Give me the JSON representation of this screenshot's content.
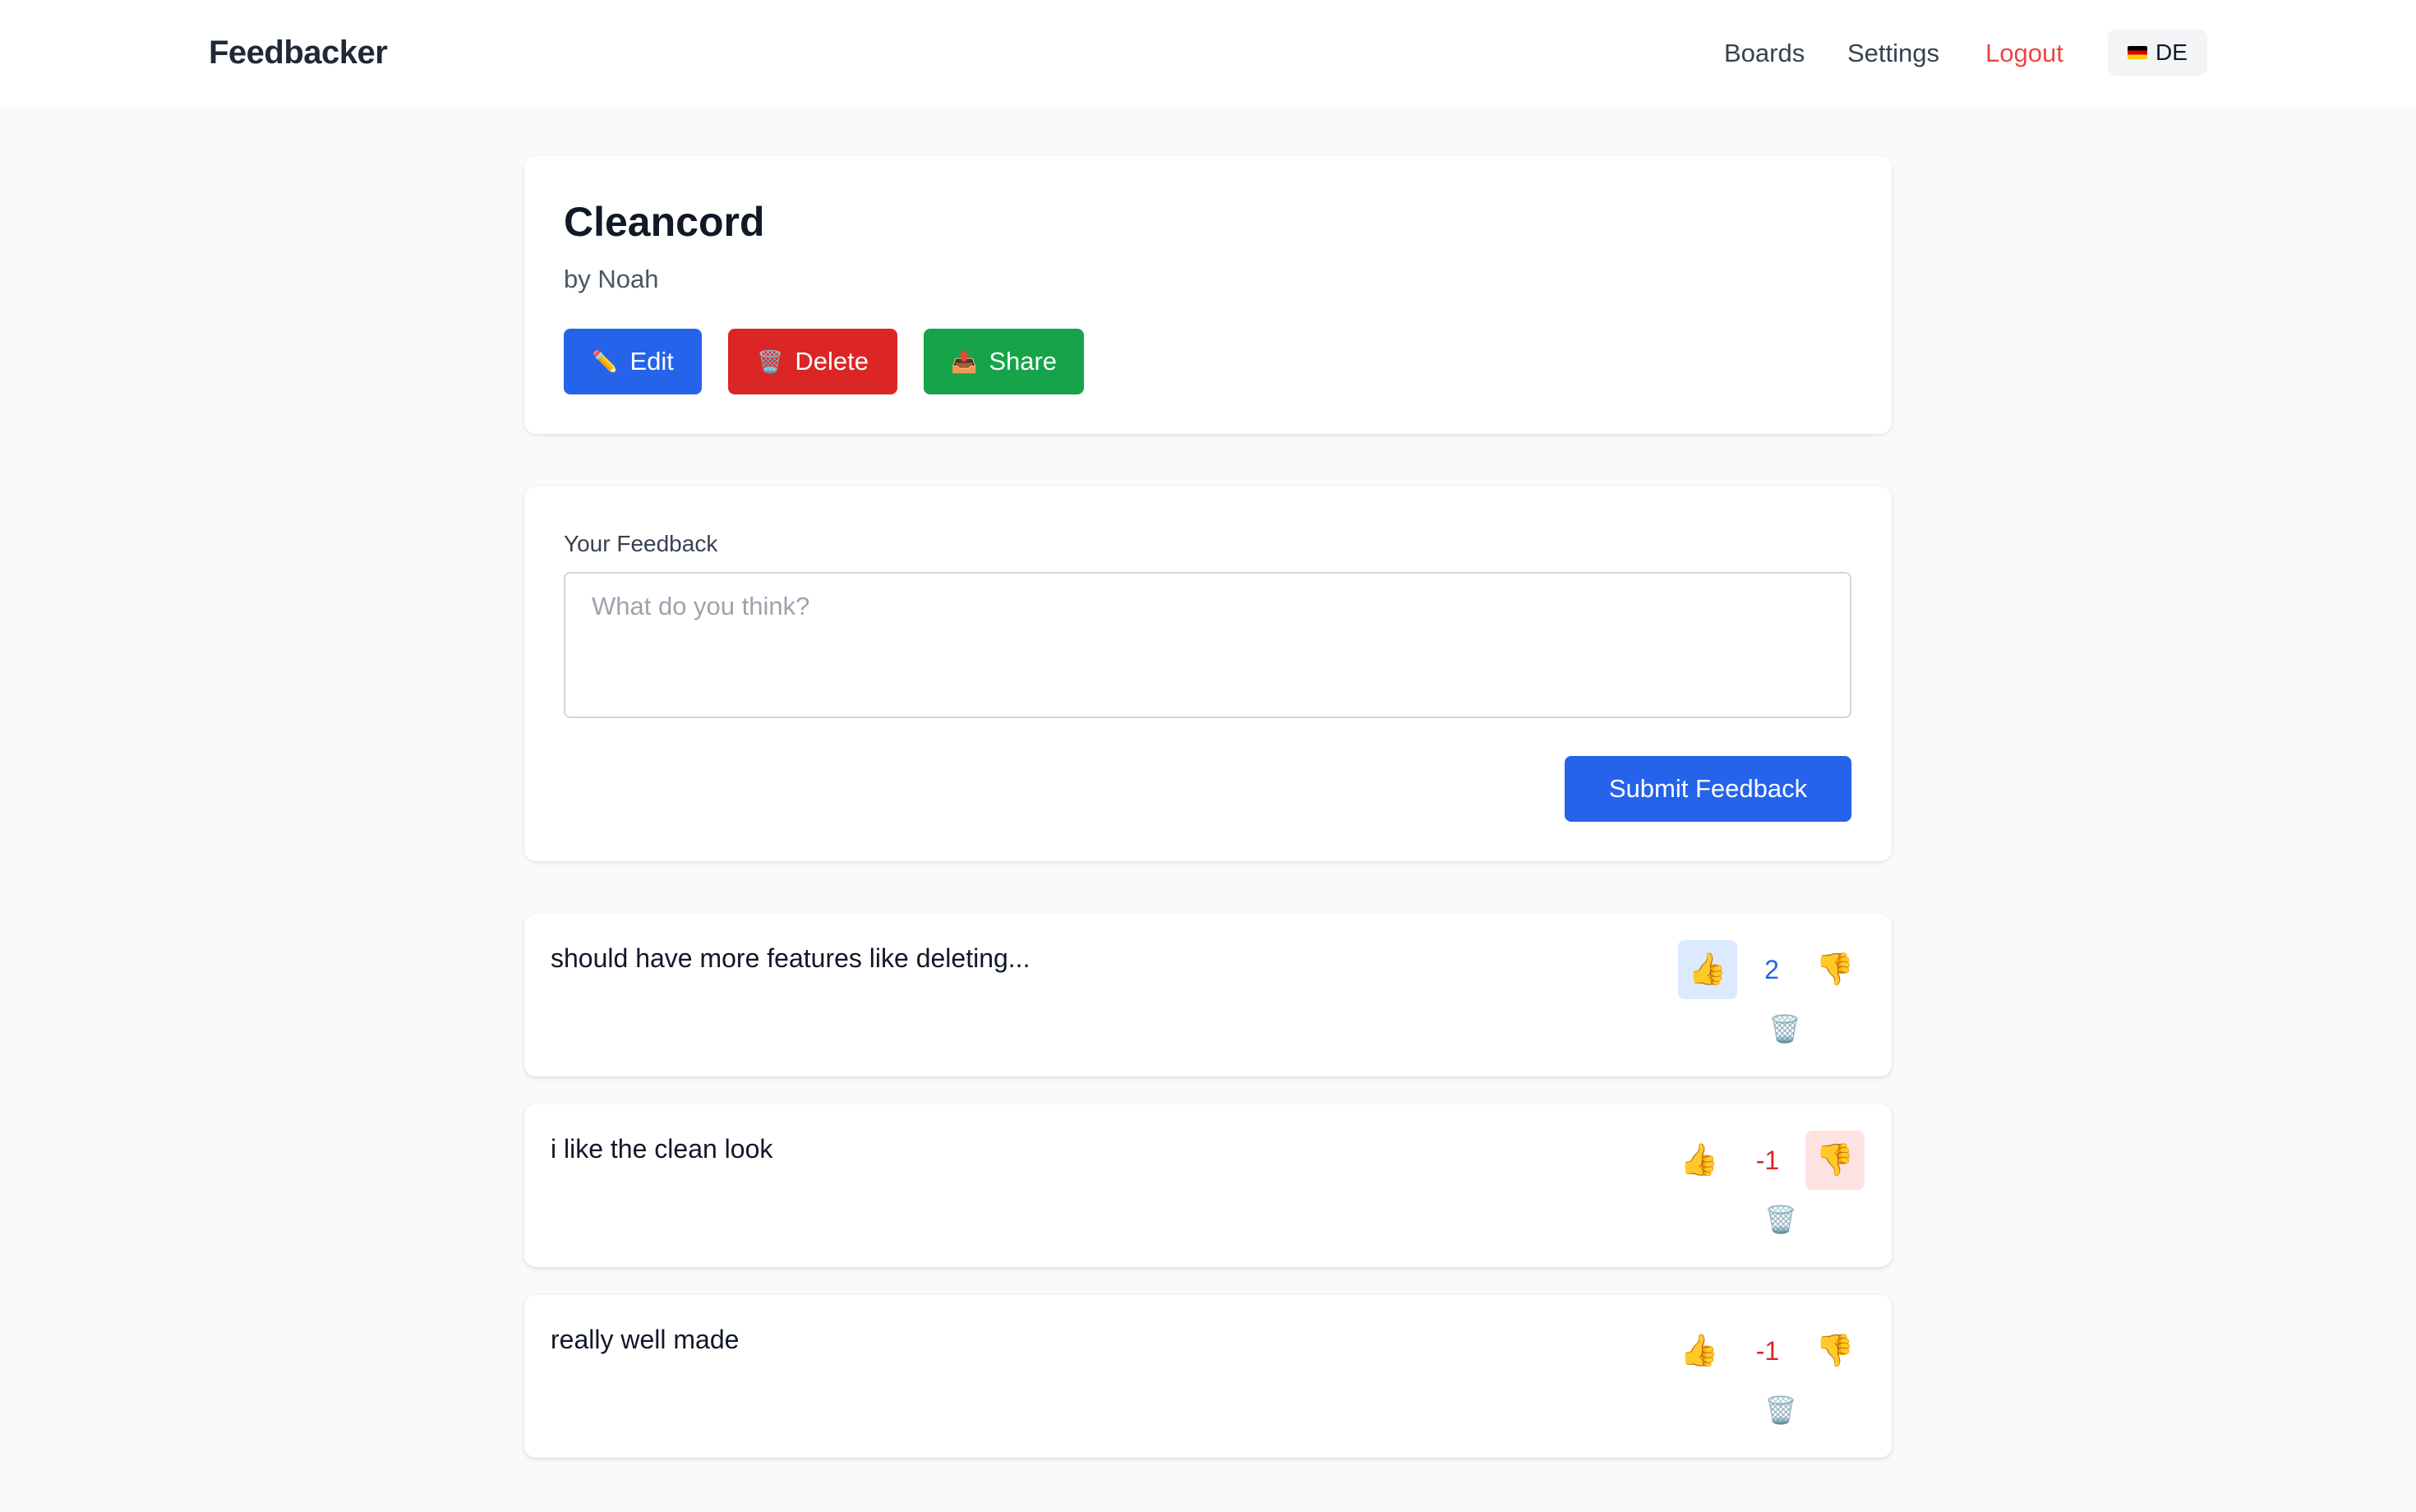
{
  "nav": {
    "brand": "Feedbacker",
    "links": {
      "boards": "Boards",
      "settings": "Settings",
      "logout": "Logout"
    },
    "language": {
      "flag_icon": "flag-de-icon",
      "label": "DE"
    }
  },
  "board": {
    "title": "Cleancord",
    "author": "by Noah",
    "actions": {
      "edit": {
        "icon": "✏️",
        "label": "Edit"
      },
      "delete": {
        "icon": "🗑️",
        "label": "Delete"
      },
      "share": {
        "icon": "📤",
        "label": "Share"
      }
    }
  },
  "feedback_form": {
    "label": "Your Feedback",
    "placeholder": "What do you think?",
    "value": "",
    "submit_label": "Submit Feedback"
  },
  "feedback_items": [
    {
      "text": "should have more features like deleting...",
      "score": "2",
      "up_icon": "👍",
      "down_icon": "👎",
      "trash_icon": "🗑️",
      "user_vote": "up"
    },
    {
      "text": "i like the clean look",
      "score": "-1",
      "up_icon": "👍",
      "down_icon": "👎",
      "trash_icon": "🗑️",
      "user_vote": "down"
    },
    {
      "text": "really well made",
      "score": "-1",
      "up_icon": "👍",
      "down_icon": "👎",
      "trash_icon": "🗑️",
      "user_vote": "none"
    }
  ],
  "colors": {
    "primary": "#2563eb",
    "danger": "#dc2626",
    "success": "#16a34a",
    "logout": "#ef4444",
    "upvote_active_bg": "#dbeafe",
    "downvote_active_bg": "#fee2e2"
  }
}
